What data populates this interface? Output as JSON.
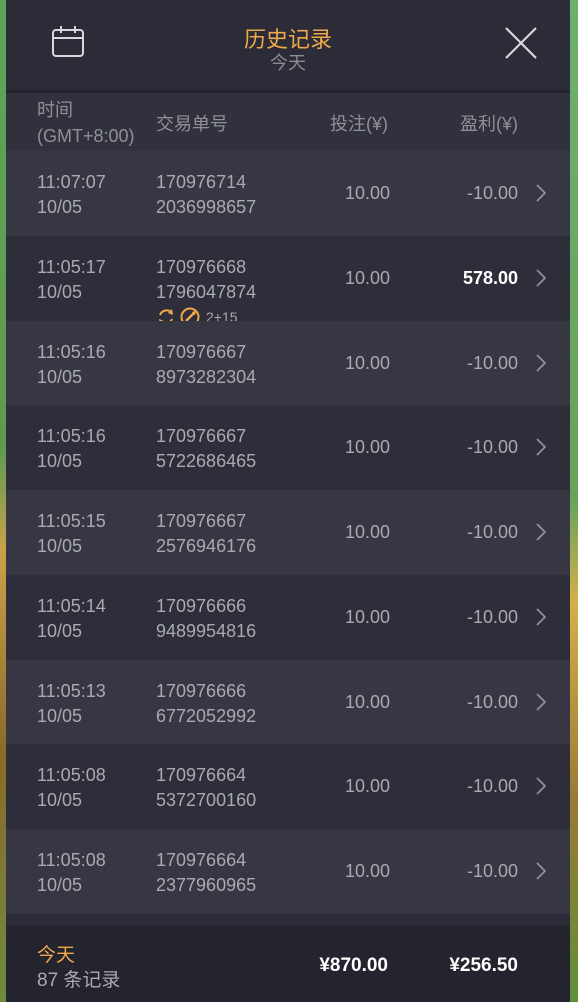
{
  "header": {
    "title": "历史记录",
    "subtitle": "今天"
  },
  "columns": {
    "time": "时间",
    "timezone": "(GMT+8:00)",
    "order": "交易单号",
    "bet": "投注(¥)",
    "profit": "盈利(¥)"
  },
  "rows": [
    {
      "time": "11:07:07",
      "date": "10/05",
      "order1": "170976714",
      "order2": "2036998657",
      "bet": "10.00",
      "profit": "-10.00",
      "win": false
    },
    {
      "time": "11:05:17",
      "date": "10/05",
      "order1": "170976668",
      "order2": "1796047874",
      "bet": "10.00",
      "profit": "578.00",
      "win": true,
      "badge": "2+15"
    },
    {
      "time": "11:05:16",
      "date": "10/05",
      "order1": "170976667",
      "order2": "8973282304",
      "bet": "10.00",
      "profit": "-10.00",
      "win": false
    },
    {
      "time": "11:05:16",
      "date": "10/05",
      "order1": "170976667",
      "order2": "5722686465",
      "bet": "10.00",
      "profit": "-10.00",
      "win": false
    },
    {
      "time": "11:05:15",
      "date": "10/05",
      "order1": "170976667",
      "order2": "2576946176",
      "bet": "10.00",
      "profit": "-10.00",
      "win": false
    },
    {
      "time": "11:05:14",
      "date": "10/05",
      "order1": "170976666",
      "order2": "9489954816",
      "bet": "10.00",
      "profit": "-10.00",
      "win": false
    },
    {
      "time": "11:05:13",
      "date": "10/05",
      "order1": "170976666",
      "order2": "6772052992",
      "bet": "10.00",
      "profit": "-10.00",
      "win": false
    },
    {
      "time": "11:05:08",
      "date": "10/05",
      "order1": "170976664",
      "order2": "5372700160",
      "bet": "10.00",
      "profit": "-10.00",
      "win": false
    },
    {
      "time": "11:05:08",
      "date": "10/05",
      "order1": "170976664",
      "order2": "2377960965",
      "bet": "10.00",
      "profit": "-10.00",
      "win": false
    }
  ],
  "footer": {
    "today": "今天",
    "count": "87 条记录",
    "total_bet": "¥870.00",
    "total_profit": "¥256.50"
  },
  "colors": {
    "accent": "#f0a94a",
    "panel": "#2b2c37",
    "row_odd": "#363743",
    "row_even": "#2d2e39"
  },
  "icons": {
    "calendar": "calendar-icon",
    "close": "close-icon",
    "chevron": "chevron-right-icon",
    "respin": "respin-icon",
    "freespin": "free-spin-icon"
  }
}
